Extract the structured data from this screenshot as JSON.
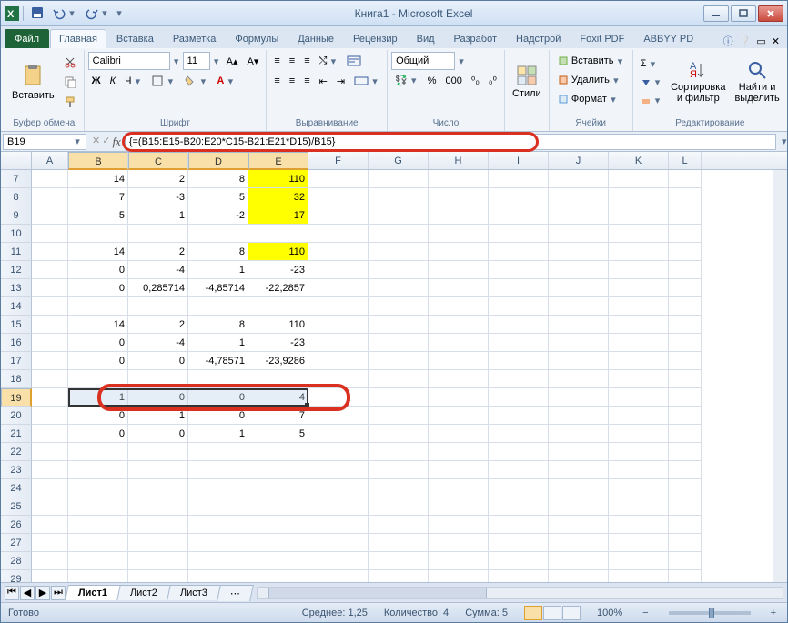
{
  "title": "Книга1 - Microsoft Excel",
  "tabs": {
    "file": "Файл",
    "home": "Главная",
    "insert": "Вставка",
    "layout": "Разметка",
    "formulas": "Формулы",
    "data": "Данные",
    "review": "Рецензир",
    "view": "Вид",
    "dev": "Разработ",
    "addins": "Надстрой",
    "foxit": "Foxit PDF",
    "abbyy": "ABBYY PD"
  },
  "ribbon": {
    "clipboard": {
      "paste": "Вставить",
      "label": "Буфер обмена"
    },
    "font": {
      "name": "Calibri",
      "size": "11",
      "label": "Шрифт"
    },
    "align": {
      "label": "Выравнивание"
    },
    "number": {
      "format": "Общий",
      "label": "Число"
    },
    "styles": {
      "btn": "Стили"
    },
    "cells": {
      "insert": "Вставить",
      "delete": "Удалить",
      "format": "Формат",
      "label": "Ячейки"
    },
    "editing": {
      "sort": "Сортировка и фильтр",
      "find": "Найти и выделить",
      "label": "Редактирование"
    }
  },
  "namebox": "B19",
  "formula": "{=(B15:E15-B20:E20*C15-B21:E21*D15)/B15}",
  "cols": [
    "A",
    "B",
    "C",
    "D",
    "E",
    "F",
    "G",
    "H",
    "I",
    "J",
    "K",
    "L"
  ],
  "rows": [
    "7",
    "8",
    "9",
    "10",
    "11",
    "12",
    "13",
    "14",
    "15",
    "16",
    "17",
    "18",
    "19",
    "20",
    "21"
  ],
  "cells": {
    "7": {
      "B": "14",
      "C": "2",
      "D": "8",
      "E": "110"
    },
    "8": {
      "B": "7",
      "C": "-3",
      "D": "5",
      "E": "32"
    },
    "9": {
      "B": "5",
      "C": "1",
      "D": "-2",
      "E": "17"
    },
    "11": {
      "B": "14",
      "C": "2",
      "D": "8",
      "E": "110"
    },
    "12": {
      "B": "0",
      "C": "-4",
      "D": "1",
      "E": "-23"
    },
    "13": {
      "B": "0",
      "C": "0,285714",
      "D": "-4,85714",
      "E": "-22,2857"
    },
    "15": {
      "B": "14",
      "C": "2",
      "D": "8",
      "E": "110"
    },
    "16": {
      "B": "0",
      "C": "-4",
      "D": "1",
      "E": "-23"
    },
    "17": {
      "B": "0",
      "C": "0",
      "D": "-4,78571",
      "E": "-23,9286"
    },
    "19": {
      "B": "1",
      "C": "0",
      "D": "0",
      "E": "4"
    },
    "20": {
      "B": "0",
      "C": "1",
      "D": "0",
      "E": "7"
    },
    "21": {
      "B": "0",
      "C": "0",
      "D": "1",
      "E": "5"
    }
  },
  "yellow": {
    "7": [
      "E"
    ],
    "8": [
      "E"
    ],
    "9": [
      "E"
    ],
    "11": [
      "E"
    ]
  },
  "sheets": {
    "s1": "Лист1",
    "s2": "Лист2",
    "s3": "Лист3"
  },
  "status": {
    "ready": "Готово",
    "avg": "Среднее: 1,25",
    "count": "Количество: 4",
    "sum": "Сумма: 5",
    "zoom": "100%"
  }
}
